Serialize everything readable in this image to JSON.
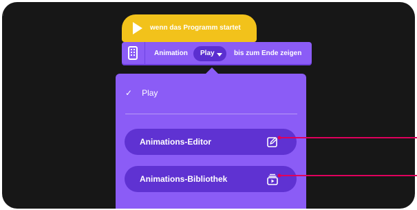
{
  "blocks": {
    "start": {
      "label": "wenn das Programm startet",
      "icon": "play-icon"
    },
    "animation": {
      "prefix": "Animation",
      "dropdown_value": "Play",
      "suffix": "bis zum Ende zeigen",
      "icon": "hub-matrix-icon"
    }
  },
  "menu": {
    "selected_option": {
      "check": "✓",
      "label": "Play"
    },
    "buttons": [
      {
        "label": "Animations-Editor",
        "icon": "edit-icon"
      },
      {
        "label": "Animations-Bibliothek",
        "icon": "library-icon"
      }
    ]
  },
  "colors": {
    "background": "#171717",
    "hat_block": "#f2c21b",
    "animation_block": "#8b5cf6",
    "dropdown": "#5b2fd0",
    "menu_button": "#5f32d2",
    "callout_line": "#e0005c"
  }
}
